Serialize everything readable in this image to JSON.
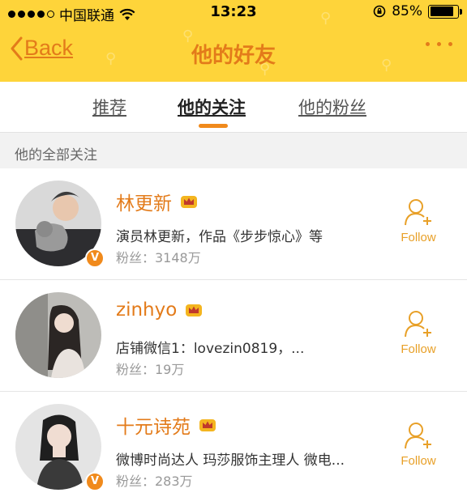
{
  "status_bar": {
    "carrier": "中国联通",
    "time": "13:23",
    "battery_percent": "85%",
    "battery_level": 0.85,
    "icons": [
      "signal-dots-icon",
      "wifi-icon",
      "rotation-lock-icon",
      "battery-icon"
    ]
  },
  "nav": {
    "back_label": "Back",
    "title": "他的好友",
    "more_icon": "more-dots-icon"
  },
  "tabs": [
    {
      "label": "推荐",
      "active": false
    },
    {
      "label": "他的关注",
      "active": true
    },
    {
      "label": "他的粉丝",
      "active": false
    }
  ],
  "section_title": "他的全部关注",
  "follows": [
    {
      "name": "林更新",
      "description": "演员林更新，作品《步步惊心》等",
      "fans": "粉丝：3148万",
      "verified": true,
      "follow_label": "Follow"
    },
    {
      "name": "zinhyo",
      "description": "店铺微信1：lovezin0819，...",
      "fans": "粉丝：19万",
      "verified": false,
      "follow_label": "Follow"
    },
    {
      "name": "十元诗苑",
      "description": "微博时尚达人 玛莎服饰主理人 微电...",
      "fans": "粉丝：283万",
      "verified": true,
      "follow_label": "Follow"
    }
  ],
  "colors": {
    "header_bg": "#fed43a",
    "accent_orange": "#e37b1a",
    "follow_gold": "#e8a028",
    "tab_indicator": "#f08a1c"
  }
}
